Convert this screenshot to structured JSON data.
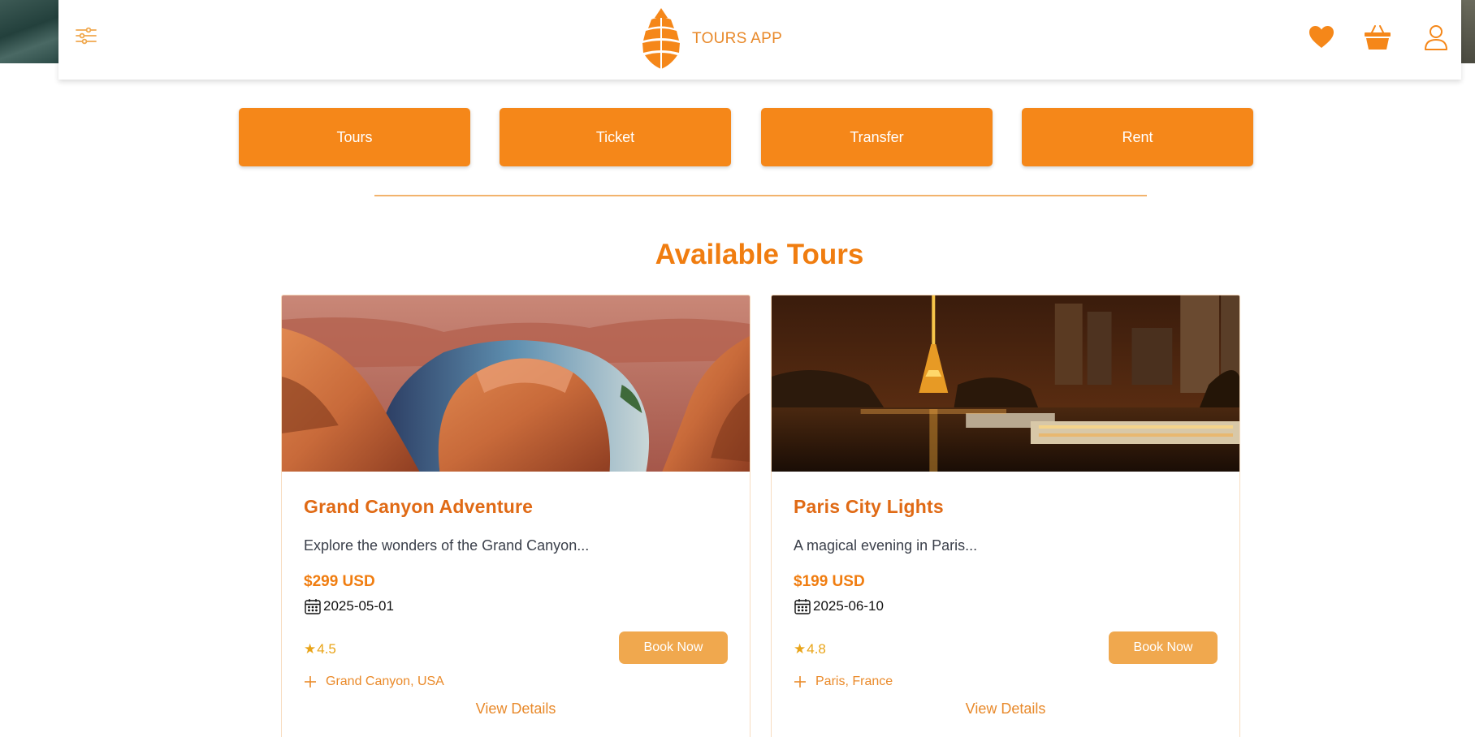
{
  "brand": {
    "name": "TOURS APP"
  },
  "categories": [
    {
      "label": "Tours"
    },
    {
      "label": "Ticket"
    },
    {
      "label": "Transfer"
    },
    {
      "label": "Rent"
    }
  ],
  "section": {
    "title": "Available Tours"
  },
  "tours": [
    {
      "title": "Grand Canyon Adventure",
      "description": "Explore the wonders of the Grand Canyon...",
      "price": "$299 USD",
      "date": "2025-05-01",
      "rating": "4.5",
      "book_label": "Book Now",
      "location": "Grand Canyon, USA",
      "details_label": "View Details"
    },
    {
      "title": "Paris City Lights",
      "description": "A magical evening in Paris...",
      "price": "$199 USD",
      "date": "2025-06-10",
      "rating": "4.8",
      "book_label": "Book Now",
      "location": "Paris, France",
      "details_label": "View Details"
    }
  ],
  "icons": {
    "filter": "sliders-icon",
    "logo": "pinecone-logo-icon",
    "favorites": "heart-icon",
    "cart": "basket-icon",
    "account": "user-icon",
    "date": "calendar-icon",
    "rating": "star-icon",
    "location": "plus-icon"
  },
  "colors": {
    "accent": "#f58719",
    "title": "#f07d10",
    "card_title": "#e06a15",
    "book_button": "#f0a84e",
    "rating": "#e9a418",
    "divider": "#f2b36d",
    "card_border": "#f7dcc0"
  }
}
